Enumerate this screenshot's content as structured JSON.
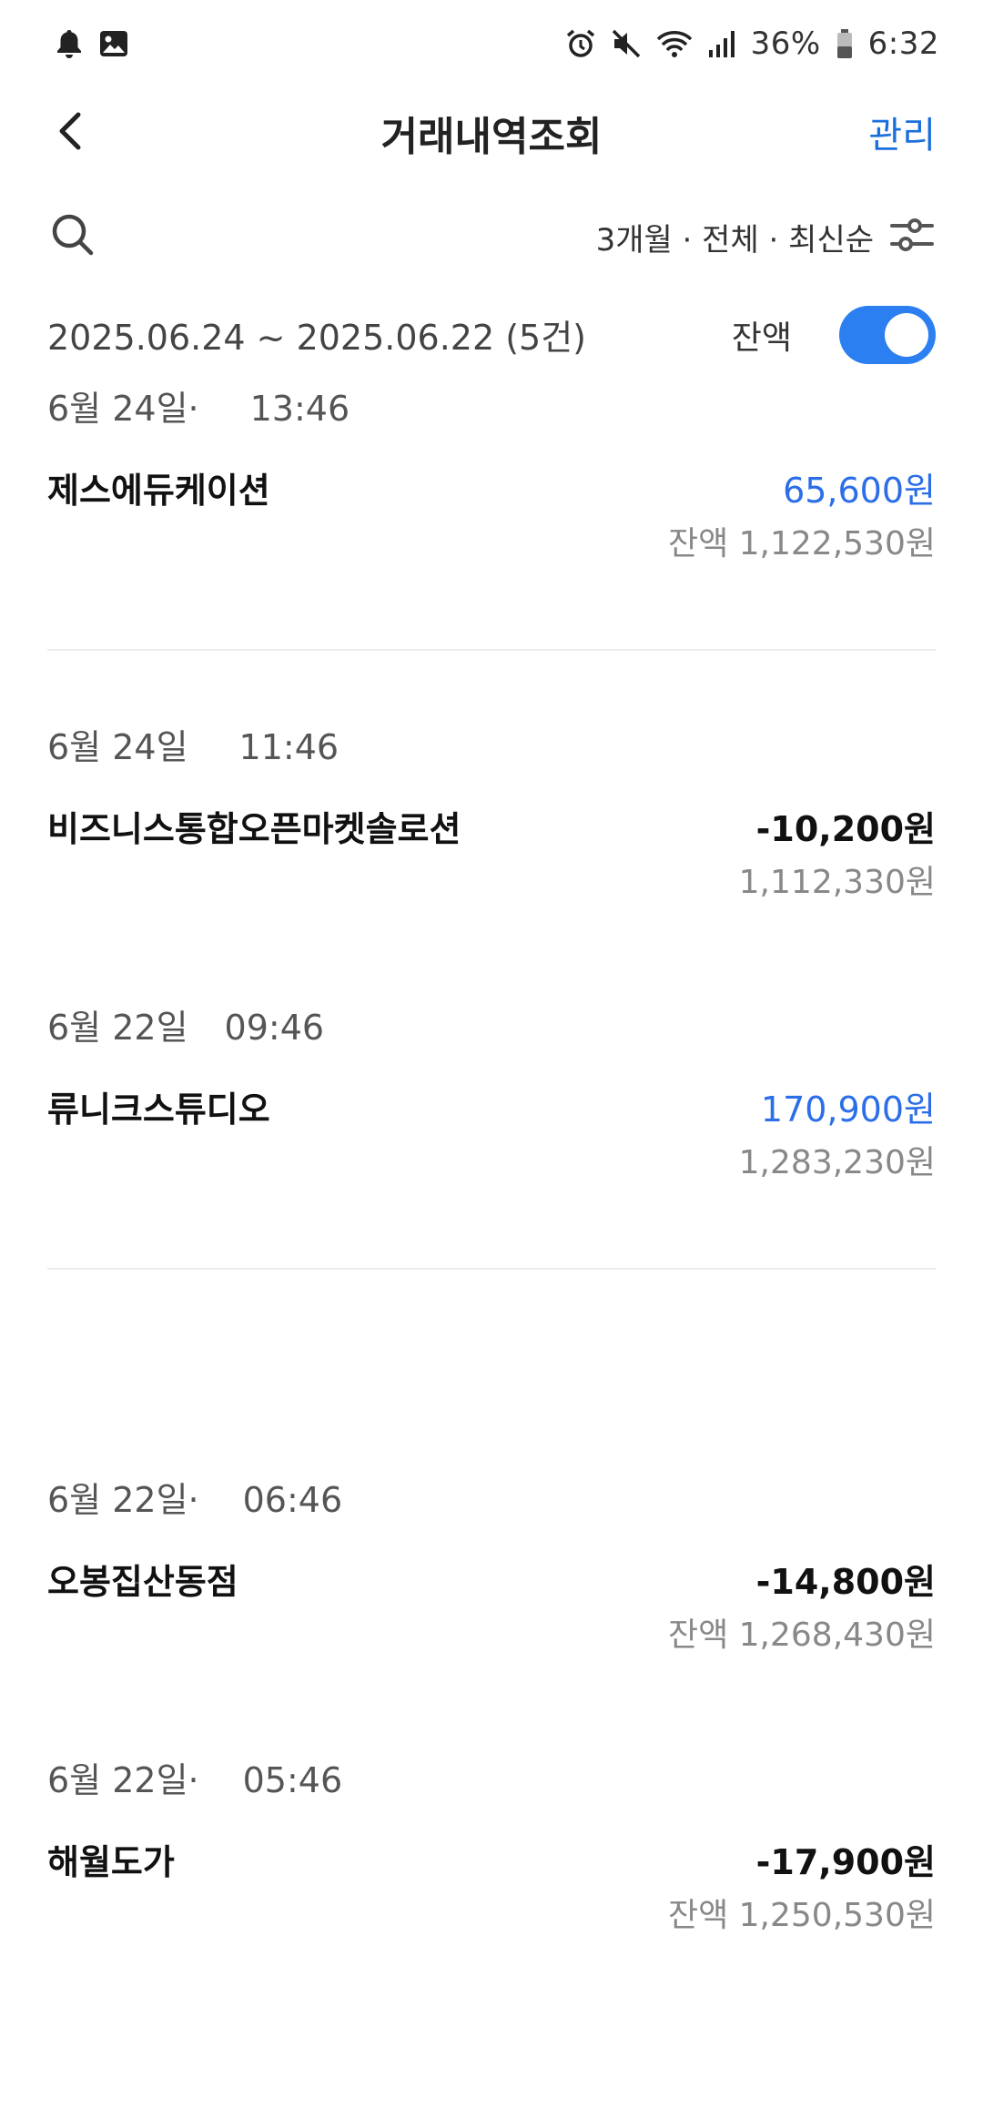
{
  "status_bar": {
    "battery": "36%",
    "time": "6:32",
    "left_icons": [
      "bell-icon",
      "image-icon"
    ],
    "right_icons": [
      "alarm-icon",
      "mute-icon",
      "wifi-icon",
      "signal-icon",
      "battery-icon"
    ]
  },
  "header": {
    "title": "거래내역조회",
    "manage_label": "관리"
  },
  "filter": {
    "summary": "3개월 · 전체 · 최신순"
  },
  "range": {
    "text": "2025.06.24 ~ 2025.06.22 (5건)",
    "balance_toggle_label": "잔액",
    "balance_toggle_on": true
  },
  "colors": {
    "accent": "#1a6fdc",
    "deposit": "#2b6ee8",
    "toggle": "#2b7ff0"
  },
  "transactions": [
    {
      "date": "6월 24일·",
      "time": "13:46",
      "name": "제스에듀케이션",
      "amount": "65,600원",
      "balance": "잔액 1,122,530원"
    },
    {
      "date": "6월 24일",
      "time": "11:46",
      "name": "비즈니스통합오픈마켓솔로션",
      "amount": "-10,200원",
      "balance": "1,112,330원"
    },
    {
      "date": "6월 22일",
      "time": "09:46",
      "name": "류니크스튜디오",
      "amount": "170,900원",
      "balance": "1,283,230원"
    },
    {
      "date": "6월 22일·",
      "time": "06:46",
      "name": "오봉집산동점",
      "amount": "-14,800원",
      "balance": "잔액 1,268,430원"
    },
    {
      "date": "6월 22일·",
      "time": "05:46",
      "name": "해월도가",
      "amount": "-17,900원",
      "balance": "잔액 1,250,530원"
    }
  ]
}
